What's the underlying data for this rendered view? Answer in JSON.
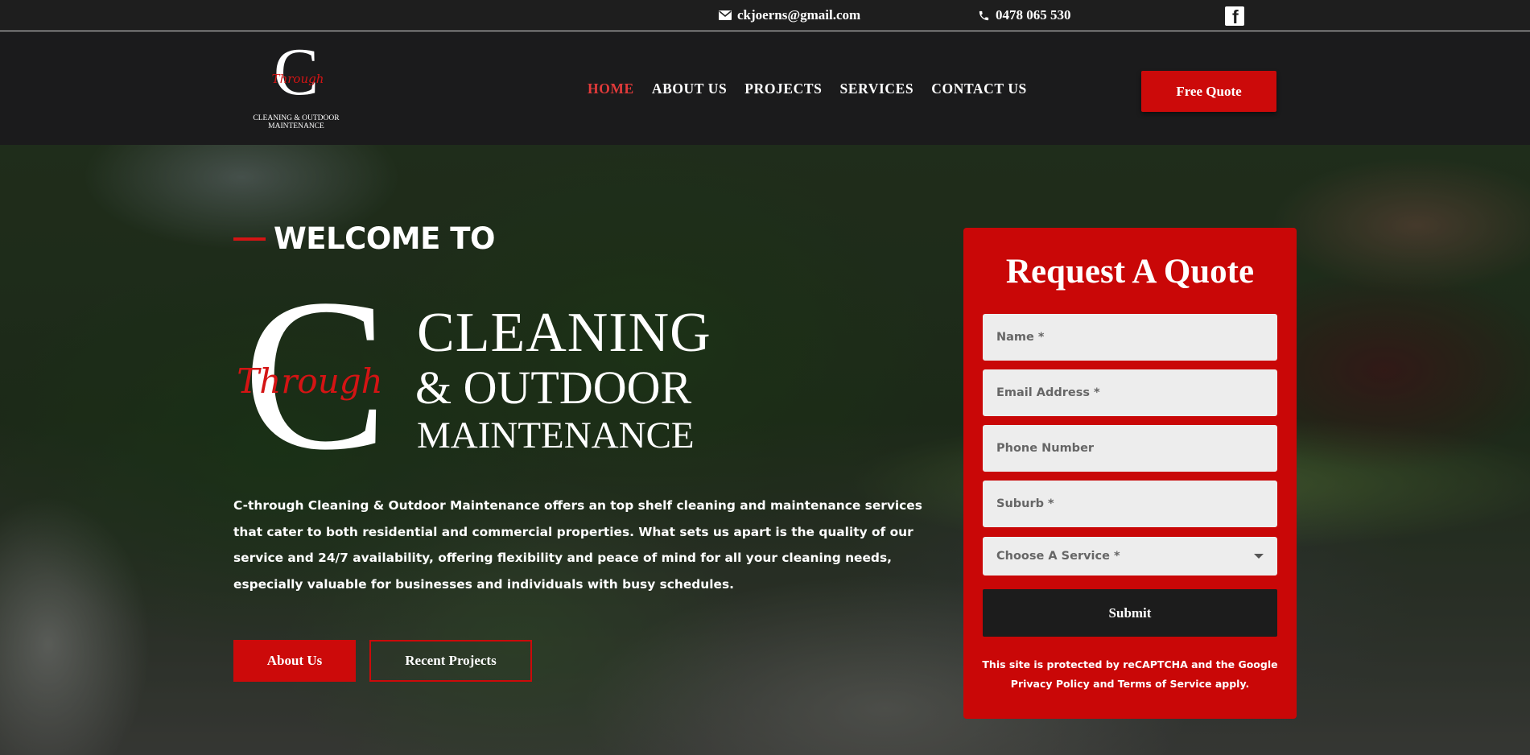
{
  "topbar": {
    "email_icon": "envelope-icon",
    "email": "ckjoerns@gmail.com",
    "phone_icon": "phone-icon",
    "phone": "0478 065 530",
    "social_icon": "facebook-icon"
  },
  "header": {
    "logo_text_line1": "CLEANING & OUTDOOR",
    "logo_text_line2": "MAINTENANCE",
    "logo_script": "Through",
    "nav": [
      "HOME",
      "ABOUT US",
      "PROJECTS",
      "SERVICES",
      "CONTACT US"
    ],
    "active_nav": "HOME",
    "cta_label": "Free Quote"
  },
  "hero": {
    "welcome": "WELCOME TO",
    "logo_line1": "CLEANING",
    "logo_line2": "& OUTDOOR",
    "logo_line3": "MAINTENANCE",
    "logo_script": "Through",
    "description": "C-through Cleaning & Outdoor Maintenance offers an top shelf cleaning and maintenance services that cater to both residential and commercial properties. What sets us apart is the quality of our service and 24/7 availability, offering flexibility and peace of mind for all your cleaning needs, especially valuable for businesses and individuals with busy schedules.",
    "btn_about": "About Us",
    "btn_projects": "Recent Projects"
  },
  "quote_form": {
    "title": "Request A Quote",
    "name_placeholder": "Name *",
    "email_placeholder": "Email Address *",
    "phone_placeholder": "Phone Number",
    "suburb_placeholder": "Suburb *",
    "service_selected": "Choose A Service *",
    "submit": "Submit",
    "recaptcha_line1": "This site is protected by reCAPTCHA and the Google",
    "privacy_link": "Privacy Policy",
    "and_text": "and",
    "terms_link": "Terms of Service",
    "apply_text": "apply."
  },
  "colors": {
    "accent_red": "#cc0a0a",
    "active_nav": "#e23a3a",
    "dark": "#1b1b1b"
  }
}
